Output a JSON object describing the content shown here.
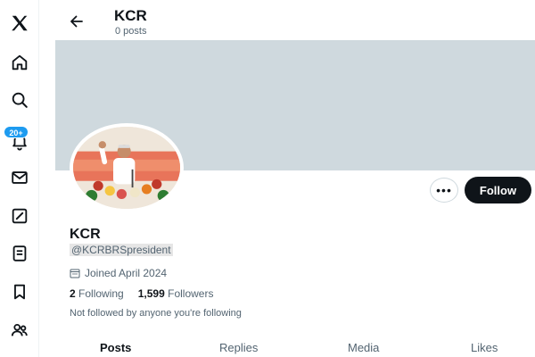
{
  "header": {
    "name": "KCR",
    "posts_count": "0 posts"
  },
  "notifications_badge": "20+",
  "profile": {
    "name": "KCR",
    "handle": "@KCRBRSpresident",
    "joined": "Joined April 2024",
    "following_count": "2",
    "following_label": "Following",
    "followers_count": "1,599",
    "followers_label": "Followers",
    "not_followed": "Not followed by anyone you're following"
  },
  "actions": {
    "more": "•••",
    "follow": "Follow"
  },
  "tabs": [
    {
      "label": "Posts",
      "active": true
    },
    {
      "label": "Replies"
    },
    {
      "label": "Media"
    },
    {
      "label": "Likes"
    }
  ],
  "nav": [
    "x-logo-icon",
    "home-icon",
    "search-icon",
    "notifications-icon",
    "messages-icon",
    "grok-icon",
    "lists-icon",
    "bookmarks-icon",
    "communities-icon"
  ],
  "colors": {
    "follow_bg": "#0f1419",
    "banner": "#cfd9de",
    "badge": "#1d9bf0"
  }
}
